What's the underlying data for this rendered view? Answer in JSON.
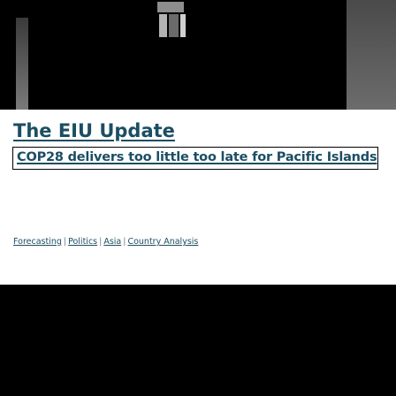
{
  "article": {
    "section_title": "The EIU Update",
    "headline": "COP28 delivers too little too late for Pacific Islands",
    "tags": [
      "Forecasting",
      "Politics",
      "Asia",
      "Country Analysis"
    ],
    "tag_separator": "|"
  },
  "colors": {
    "link": "#1c4e63",
    "background": "#000000",
    "card": "#ffffff"
  }
}
